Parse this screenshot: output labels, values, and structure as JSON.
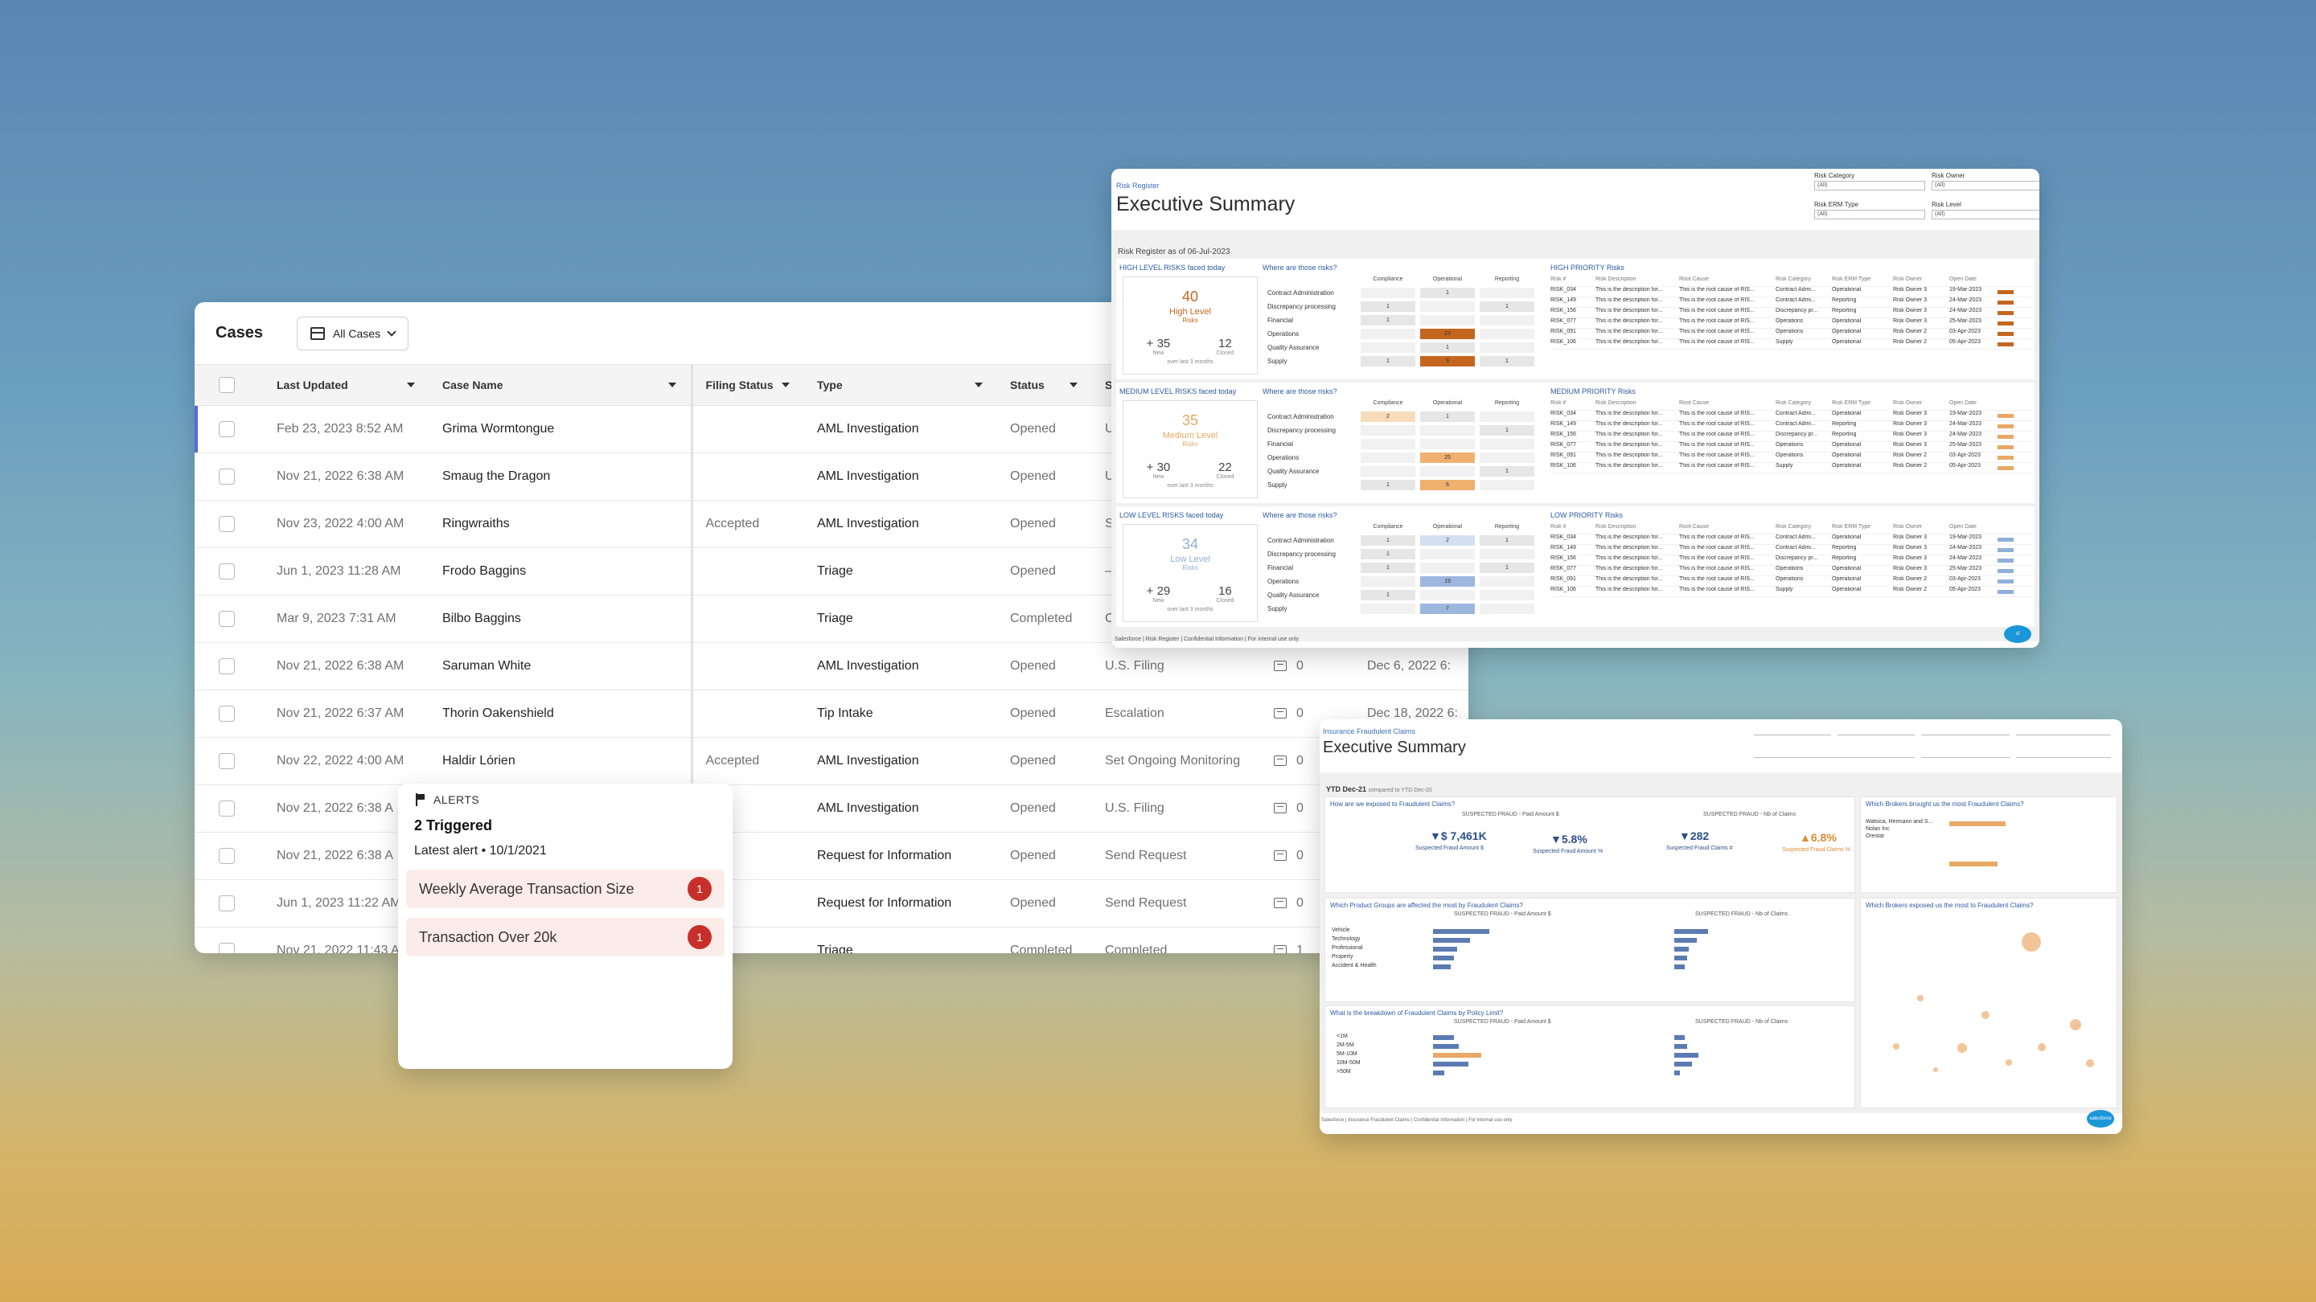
{
  "cases": {
    "title": "Cases",
    "view": "All Cases",
    "columns": [
      "Last Updated",
      "Case Name",
      "Filing Status",
      "Type",
      "Status",
      "St"
    ],
    "rows": [
      {
        "updated": "Feb 23, 2023 8:52 AM",
        "name": "Grima Wormtongue",
        "filing": "",
        "type": "AML Investigation",
        "status": "Opened",
        "stage": "U",
        "comments": "",
        "due": ""
      },
      {
        "updated": "Nov 21, 2022 6:38 AM",
        "name": "Smaug the Dragon",
        "filing": "",
        "type": "AML Investigation",
        "status": "Opened",
        "stage": "U",
        "comments": "",
        "due": ""
      },
      {
        "updated": "Nov 23, 2022 4:00 AM",
        "name": "Ringwraiths",
        "filing": "Accepted",
        "type": "AML Investigation",
        "status": "Opened",
        "stage": "S",
        "comments": "",
        "due": ""
      },
      {
        "updated": "Jun 1, 2023 11:28 AM",
        "name": "Frodo Baggins",
        "filing": "",
        "type": "Triage",
        "status": "Opened",
        "stage": "–",
        "comments": "",
        "due": ""
      },
      {
        "updated": "Mar 9, 2023 7:31 AM",
        "name": "Bilbo Baggins",
        "filing": "",
        "type": "Triage",
        "status": "Completed",
        "stage": "C",
        "comments": "",
        "due": ""
      },
      {
        "updated": "Nov 21, 2022 6:38 AM",
        "name": "Saruman White",
        "filing": "",
        "type": "AML Investigation",
        "status": "Opened",
        "stage": "U.S. Filing",
        "comments": "0",
        "due": "Dec 6, 2022 6:"
      },
      {
        "updated": "Nov 21, 2022 6:37 AM",
        "name": "Thorin Oakenshield",
        "filing": "",
        "type": "Tip Intake",
        "status": "Opened",
        "stage": "Escalation",
        "comments": "0",
        "due": "Dec 18, 2022 6:"
      },
      {
        "updated": "Nov 22, 2022 4:00 AM",
        "name": "Haldir Lórien",
        "filing": "Accepted",
        "type": "AML Investigation",
        "status": "Opened",
        "stage": "Set Ongoing Monitoring",
        "comments": "0",
        "due": ""
      },
      {
        "updated": "Nov 21, 2022 6:38 A",
        "name": "",
        "filing": "",
        "type": "AML Investigation",
        "status": "Opened",
        "stage": "U.S. Filing",
        "comments": "0",
        "due": ""
      },
      {
        "updated": "Nov 21, 2022 6:38 A",
        "name": "",
        "filing": "",
        "type": "Request for Information",
        "status": "Opened",
        "stage": "Send Request",
        "comments": "0",
        "due": ""
      },
      {
        "updated": "Jun 1, 2023 11:22 AM",
        "name": "",
        "filing": "",
        "type": "Request for Information",
        "status": "Opened",
        "stage": "Send Request",
        "comments": "0",
        "due": ""
      },
      {
        "updated": "Nov 21, 2022 11:43 A",
        "name": "",
        "filing": "",
        "type": "Triage",
        "status": "Completed",
        "stage": "Completed",
        "comments": "1",
        "due": ""
      }
    ]
  },
  "alerts": {
    "heading": "ALERTS",
    "count": "2 Triggered",
    "latest": "Latest alert  •  10/1/2021",
    "items": [
      {
        "label": "Weekly Average Transaction Size",
        "badge": "1"
      },
      {
        "label": "Transaction Over 20k",
        "badge": "1"
      }
    ]
  },
  "risk": {
    "crumb": "Risk Register",
    "title": "Executive Summary",
    "filters": [
      {
        "label": "Risk Category",
        "value": "(All)"
      },
      {
        "label": "Risk Owner",
        "value": "(All)"
      },
      {
        "label": "Risk ERM Type",
        "value": "(All)"
      },
      {
        "label": "Risk Level",
        "value": "(All)"
      }
    ],
    "asof": "Risk Register as of 06-Jul-2023",
    "matrix_cols": [
      "Compliance",
      "Operational",
      "Reporting"
    ],
    "matrix_rows": [
      "Contract Administration",
      "Discrepancy processing",
      "Financial",
      "Operations",
      "Quality Assurance",
      "Supply"
    ],
    "sections": [
      {
        "kpi_title": "HIGH LEVEL RISKS faced today",
        "num": "40",
        "level": "High Level",
        "sub": "Risks",
        "new": "+ 35",
        "closed": "12",
        "color": "#c4661f",
        "matrix_title": "Where are those risks?",
        "prio_title": "HIGH PRIORITY Risks"
      },
      {
        "kpi_title": "MEDIUM LEVEL RISKS faced today",
        "num": "35",
        "level": "Medium Level",
        "sub": "Risks",
        "new": "+ 30",
        "closed": "22",
        "color": "#e9a865",
        "matrix_title": "Where are those risks?",
        "prio_title": "MEDIUM PRIORITY Risks"
      },
      {
        "kpi_title": "LOW LEVEL RISKS faced today",
        "num": "34",
        "level": "Low Level",
        "sub": "Risks",
        "new": "+ 29",
        "closed": "16",
        "color": "#8fb0da",
        "matrix_title": "Where are those risks?",
        "prio_title": "LOW PRIORITY Risks"
      }
    ],
    "new_label": "New",
    "closed_label": "Closed",
    "period": "over last 3 months",
    "prio_header": [
      "Risk #",
      "Risk Description",
      "Root Cause",
      "Risk Category",
      "Risk ERM Type",
      "Risk Owner",
      "Open Date"
    ],
    "prio_rows": [
      [
        "RISK_034",
        "This is the description for...",
        "This is the root cause of RIS...",
        "Contract Admi...",
        "Operational",
        "Risk Owner 3",
        "19-Mar-2023"
      ],
      [
        "RISK_149",
        "This is the description for...",
        "This is the root cause of RIS...",
        "Contract Admi...",
        "Reporting",
        "Risk Owner 3",
        "24-Mar-2023"
      ],
      [
        "RISK_156",
        "This is the description for...",
        "This is the root cause of RIS...",
        "Discrepancy pr...",
        "Reporting",
        "Risk Owner 3",
        "24-Mar-2023"
      ],
      [
        "RISK_077",
        "This is the description for...",
        "This is the root cause of RIS...",
        "Operations",
        "Operational",
        "Risk Owner 3",
        "25-Mar-2023"
      ],
      [
        "RISK_091",
        "This is the description for...",
        "This is the root cause of RIS...",
        "Operations",
        "Operational",
        "Risk Owner 2",
        "03-Apr-2023"
      ],
      [
        "RISK_106",
        "This is the description for...",
        "This is the root cause of RIS...",
        "Supply",
        "Operational",
        "Risk Owner 2",
        "05-Apr-2023"
      ]
    ],
    "footer": "Salesforce | Risk Register | Confidential Information | For internal use only"
  },
  "insurance": {
    "crumb": "Insurance Fraudulent Claims",
    "title": "Executive Summary",
    "period": "YTD Dec-21",
    "compared": "compared to YTD Dec-20",
    "q1": "How are we exposed to Fraudulent Claims?",
    "q2": "Which Brokers brought us the most Fraudulent Claims?",
    "q3": "Which Product Groups are affected the most by Fraudulent Claims?",
    "q4": "Which Brokers exposed us the most to Fraudulent Claims?",
    "q5": "What is the breakdown of Fraudulent Claims by Policy Limit?",
    "kpis": [
      {
        "value": "▼$ 7,461K",
        "label": "Suspected Fraud Amount $"
      },
      {
        "value": "▼5.8%",
        "label": "Suspected Fraud Amount %"
      },
      {
        "value": "▼282",
        "label": "Suspected Fraud Claims #"
      },
      {
        "value": "▲6.8%",
        "label": "Suspected Fraud Claims %"
      }
    ],
    "card_head_amount": "SUSPECTED FRAUD - Paid Amount $",
    "card_head_claims": "SUSPECTED FRAUD - Nb of Claims",
    "products": [
      "Vehicle",
      "Technology",
      "Professional",
      "Property",
      "Accident & Health"
    ],
    "limits": [
      "<1M",
      "2M-5M",
      "5M-10M",
      "10M-50M",
      ">50M"
    ],
    "brokers": [
      "Watsica, Hermann and S...",
      "Nolan Inc",
      "Orestar"
    ],
    "footer": "Salesforce | Insurance Fraudulent Claims | Confidential Information | For internal use only",
    "logo": "salesforce"
  }
}
